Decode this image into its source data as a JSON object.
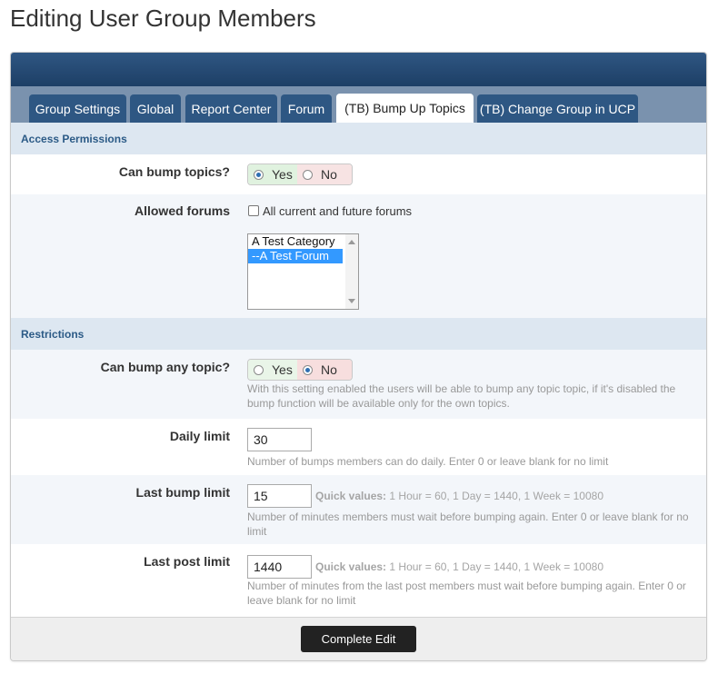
{
  "page": {
    "title": "Editing User Group Members"
  },
  "tabs": [
    {
      "label": "Group Settings",
      "active": false
    },
    {
      "label": "Global",
      "active": false
    },
    {
      "label": "Report Center",
      "active": false
    },
    {
      "label": "Forum",
      "active": false
    },
    {
      "label": "(TB) Bump Up Topics",
      "active": true
    },
    {
      "label": "(TB) Change Group in UCP",
      "active": false
    }
  ],
  "sections": {
    "access": "Access Permissions",
    "restrictions": "Restrictions"
  },
  "fields": {
    "can_bump_topics": {
      "label": "Can bump topics?",
      "yes": "Yes",
      "no": "No",
      "value": "Yes"
    },
    "allowed_forums": {
      "label": "Allowed forums",
      "checkbox_label": "All current and future forums",
      "checked": false,
      "options": [
        "A Test Category",
        "--A Test Forum"
      ],
      "selected": "--A Test Forum"
    },
    "can_bump_any": {
      "label": "Can bump any topic?",
      "yes": "Yes",
      "no": "No",
      "value": "No",
      "hint": "With this setting enabled the users will be able to bump any topic topic, if it's disabled the bump function will be available only for the own topics."
    },
    "daily_limit": {
      "label": "Daily limit",
      "value": "30",
      "hint": "Number of bumps members can do daily. Enter 0 or leave blank for no limit"
    },
    "last_bump_limit": {
      "label": "Last bump limit",
      "value": "15",
      "quick_label": "Quick values:",
      "quick_values": "1 Hour = 60, 1 Day = 1440, 1 Week = 10080",
      "hint": "Number of minutes members must wait before bumping again. Enter 0 or leave blank for no limit"
    },
    "last_post_limit": {
      "label": "Last post limit",
      "value": "1440",
      "quick_label": "Quick values:",
      "quick_values": "1 Hour = 60, 1 Day = 1440, 1 Week = 10080",
      "hint": "Number of minutes from the last post members must wait before bumping again. Enter 0 or leave blank for no limit"
    }
  },
  "footer": {
    "submit_label": "Complete Edit"
  },
  "colors": {
    "header_bar": "#1d3f66",
    "tab_bg": "#2e5783",
    "tab_strip": "#7a92ae",
    "section_bg": "#dde7f1",
    "section_text": "#2b5a86",
    "submit_bg": "#222222"
  }
}
